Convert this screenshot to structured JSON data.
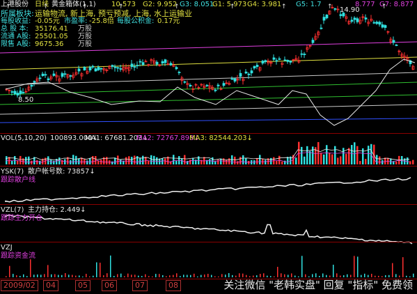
{
  "header": {
    "stock_name": "上港股份",
    "period": "日线",
    "indicator": "黄金箱体(1,1)",
    "g_labels": [
      "10.573",
      "G2: 9.952",
      "G3: 8.051",
      "G1: 5.973",
      "G4: 3.981",
      "G5: 1.7",
      "8.777",
      "G7: 8.877"
    ],
    "price_high": "14.90",
    "price_low": "8.50"
  },
  "info": {
    "sector_label": "所属板块:",
    "sector_value": "运输物流, 新上海, 预亏预减, 上海, 水上运输业",
    "eps_label": "每股收益:",
    "eps_value": "-0.05元",
    "pe_label": "市盈率:",
    "pe_value": "-25.8倍",
    "reserve_label": "每股公积金:",
    "reserve_value": "0.17元",
    "total_label": "总 股 本:",
    "total_value": "35176.41",
    "total_unit": "万股",
    "float_label": "流通 A股:",
    "float_value": "25501.05",
    "float_unit": "万股",
    "limited_label": "限售 A股:",
    "limited_value": "9675.36",
    "limited_unit": "万股"
  },
  "vol_panel": {
    "label": "VOL(5,10,20)",
    "vol": "100893.000↓",
    "ma1": "MA1: 67681.203↓",
    "ma2": "MA2: 72767.898↓",
    "ma3": "MA3: 82544.203↓"
  },
  "ysk_panel": {
    "label": "YSK(7)",
    "text": "散户帐号数: 73857↓",
    "sub": "跟踪散户线"
  },
  "vzl_panel": {
    "label": "VZL(7)",
    "text": "主力持仓: 2.449↓",
    "sub": "跟踪主力开仓"
  },
  "vzj_panel": {
    "label": "VZJ",
    "sub": "跟踪资金流"
  },
  "dates": [
    "2009/02",
    "04",
    "05",
    "06",
    "07",
    "08"
  ],
  "watermark": "关注微信 \"老韩实盘\" 回复 \"指标\" 免费领",
  "colors": {
    "bg": "#000000",
    "up": "#ff3030",
    "down": "#30e0e0",
    "text_cyan": "#40e0e0",
    "text_yellow": "#e0e040",
    "text_magenta": "#e040e0",
    "separator": "#8b0000"
  }
}
